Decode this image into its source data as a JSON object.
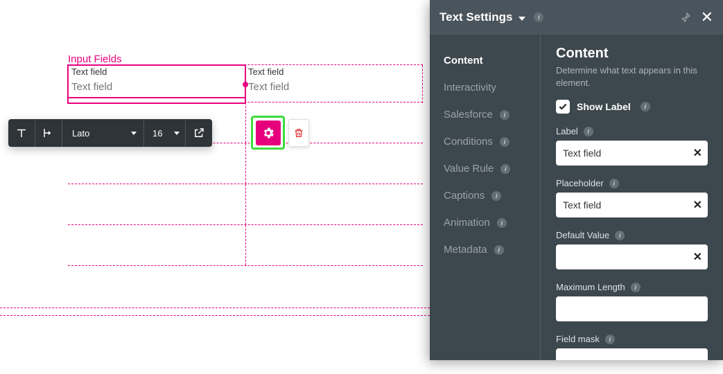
{
  "canvas": {
    "section_title": "Input Fields",
    "field1": {
      "label": "Text field",
      "placeholder": "Text field"
    },
    "field2": {
      "label": "Text field",
      "placeholder": "Text field"
    }
  },
  "toolbar": {
    "font": "Lato",
    "size": "16"
  },
  "panel": {
    "title": "Text Settings",
    "nav": [
      {
        "label": "Content",
        "info": false,
        "active": true
      },
      {
        "label": "Interactivity",
        "info": false,
        "active": false
      },
      {
        "label": "Salesforce",
        "info": true,
        "active": false
      },
      {
        "label": "Conditions",
        "info": true,
        "active": false
      },
      {
        "label": "Value Rule",
        "info": true,
        "active": false
      },
      {
        "label": "Captions",
        "info": true,
        "active": false
      },
      {
        "label": "Animation",
        "info": true,
        "active": false
      },
      {
        "label": "Metadata",
        "info": true,
        "active": false
      }
    ],
    "content": {
      "heading": "Content",
      "subtext": "Determine what text appears in this element.",
      "show_label_toggle": "Show Label",
      "show_label_checked": true,
      "label_field": {
        "label": "Label",
        "value": "Text field"
      },
      "placeholder_field": {
        "label": "Placeholder",
        "value": "Text field"
      },
      "default_value_field": {
        "label": "Default Value",
        "value": ""
      },
      "maxlen_field": {
        "label": "Maximum Length",
        "value": ""
      },
      "fieldmask_field": {
        "label": "Field mask",
        "value": ""
      }
    }
  }
}
